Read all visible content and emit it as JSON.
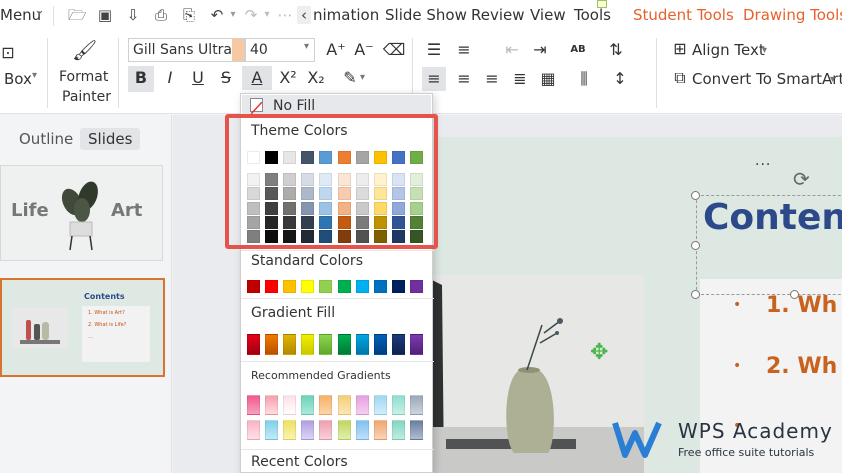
{
  "menubar": {
    "menu_label": "Menu",
    "tabs": [
      "nimation",
      "Slide Show",
      "Review",
      "View",
      "Tools"
    ],
    "accent_tabs": [
      "Student Tools",
      "Drawing Tools"
    ],
    "accent_color": "#e8612c"
  },
  "ribbon": {
    "box_label": "Box",
    "format_painter_line1": "Format",
    "format_painter_line2": "Painter",
    "font_name": "Gill Sans Ultra B",
    "font_size": "40",
    "align_text": "Align Text",
    "convert_smartart": "Convert To SmartArt",
    "bold": "B",
    "italic": "I",
    "underline": "U",
    "strike": "S",
    "font_color_glyph": "A",
    "superscript": "X²",
    "subscript": "X₂",
    "grow_font": "A⁺",
    "shrink_font": "A⁻",
    "ab_glyph": "AB"
  },
  "left_panel": {
    "tabs": [
      "Outline",
      "Slides"
    ],
    "active_tab": "Slides",
    "slide1": {
      "word_left": "Life",
      "word_right": "Art"
    },
    "slide2": {
      "title": "Contents",
      "bullet1": "1. What is Art?",
      "bullet2": "2. What is Life?",
      "bullet3": "..."
    }
  },
  "slide": {
    "title": "Conten",
    "bullets": [
      "1. Wh",
      "2. Wh"
    ],
    "watermark_title": "WPS Academy",
    "watermark_sub": "Free office suite tutorials"
  },
  "dropdown": {
    "no_fill": "No Fill",
    "theme_colors": "Theme Colors",
    "standard_colors": "Standard Colors",
    "gradient_fill": "Gradient Fill",
    "recommended_gradients": "Recommended Gradients",
    "recent_colors": "Recent Colors",
    "theme_top_row": [
      "#ffffff",
      "#000000",
      "#e7e6e6",
      "#44546a",
      "#5b9bd5",
      "#ed7d31",
      "#a5a5a5",
      "#ffc000",
      "#4472c4",
      "#70ad47"
    ],
    "theme_shades": [
      [
        "#f2f2f2",
        "#7f7f7f",
        "#d0cece",
        "#d6dce4",
        "#deebf6",
        "#fbe5d5",
        "#ededed",
        "#fff2cc",
        "#dae3f3",
        "#e2efd9"
      ],
      [
        "#d8d8d8",
        "#595959",
        "#aeabab",
        "#adb9ca",
        "#bdd7ee",
        "#f7cbac",
        "#dbdbdb",
        "#fee599",
        "#b4c6e7",
        "#c5e0b3"
      ],
      [
        "#bfbfbf",
        "#3f3f3f",
        "#757070",
        "#8496b0",
        "#9cc3e5",
        "#f4b183",
        "#c9c9c9",
        "#ffd965",
        "#8eaadb",
        "#a8d08d"
      ],
      [
        "#a5a5a5",
        "#262626",
        "#3a3838",
        "#323f4f",
        "#2e75b5",
        "#c55a11",
        "#7b7b7b",
        "#bf9000",
        "#2f5496",
        "#538135"
      ],
      [
        "#7f7f7f",
        "#0c0c0c",
        "#171616",
        "#222a35",
        "#1e4e79",
        "#833c0b",
        "#525252",
        "#7f6000",
        "#1f3864",
        "#375623"
      ]
    ],
    "standard": [
      "#c00000",
      "#ff0000",
      "#ffc000",
      "#ffff00",
      "#92d050",
      "#00b050",
      "#00b0f0",
      "#0070c0",
      "#002060",
      "#7030a0"
    ],
    "gradients": [
      [
        "#e6001a",
        "#a0000f"
      ],
      [
        "#f07a00",
        "#b85000"
      ],
      [
        "#e3b300",
        "#b38a00"
      ],
      [
        "#f0f000",
        "#c8c800"
      ],
      [
        "#8ed650",
        "#5ea82c"
      ],
      [
        "#00b050",
        "#007a36"
      ],
      [
        "#00a7e0",
        "#0076a8"
      ],
      [
        "#0060b8",
        "#003f7f"
      ],
      [
        "#1d3a7a",
        "#0f2250"
      ],
      [
        "#7c3ab0",
        "#52207a"
      ]
    ],
    "recommended_row1": [
      [
        "#f05a8c",
        "#f8a0c0"
      ],
      [
        "#f5a0b0",
        "#fdd"
      ],
      [
        "#fde0e6",
        "#fff"
      ],
      [
        "#6fd3b8",
        "#a8eadb"
      ],
      [
        "#f7b267",
        "#fbd6a7"
      ],
      [
        "#f4cf7a",
        "#fbe7b5"
      ],
      [
        "#e6a0e0",
        "#f5d0f0"
      ],
      [
        "#9fd8f0",
        "#d0eefa"
      ],
      [
        "#8fdfd0",
        "#c8f0e8"
      ],
      [
        "#9aa8b8",
        "#cdd5de"
      ]
    ],
    "recommended_row2": [
      [
        "#f9b4c2",
        "#ffe0e8"
      ],
      [
        "#7fd0e8",
        "#c0ecf7"
      ],
      [
        "#f0e060",
        "#fbf3b0"
      ],
      [
        "#b0a0e0",
        "#dcd4f4"
      ],
      [
        "#f0a0b0",
        "#f8d0d8"
      ],
      [
        "#c0d860",
        "#e0eeb0"
      ],
      [
        "#80c0f0",
        "#c0e0fa"
      ],
      [
        "#f0a870",
        "#f8d4b8"
      ],
      [
        "#80d8c0",
        "#c0ece0"
      ],
      [
        "#6a80a0",
        "#b0bcd0"
      ]
    ]
  }
}
